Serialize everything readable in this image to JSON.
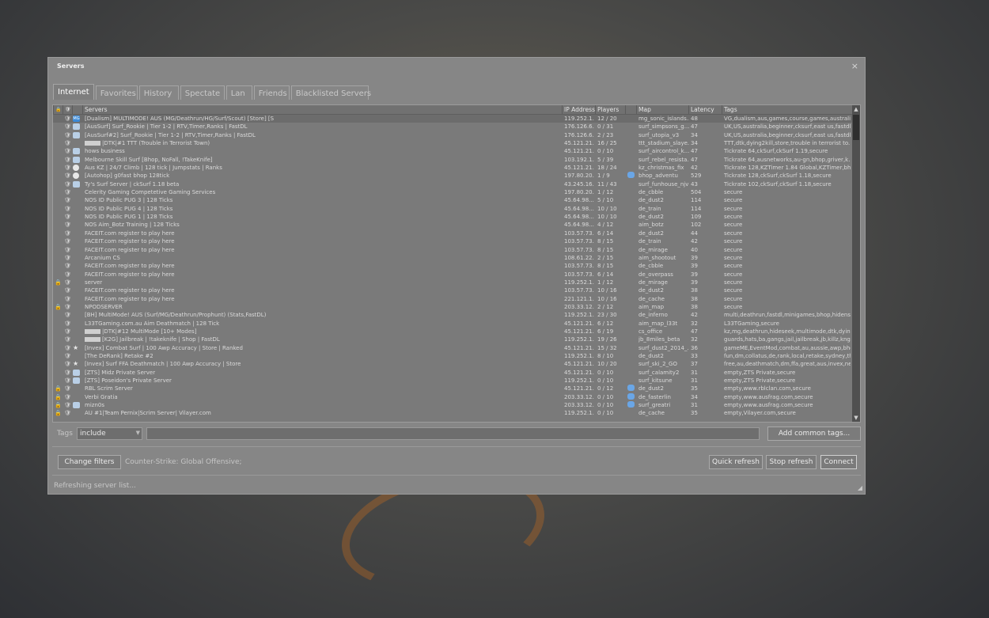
{
  "window": {
    "title": "Servers",
    "close": "×"
  },
  "tabs": [
    "Internet",
    "Favorites",
    "History",
    "Spectate",
    "Lan",
    "Friends",
    "Blacklisted Servers"
  ],
  "columns": {
    "lock": "🔒",
    "secure": "🛡",
    "bots": "",
    "servers": "Servers",
    "ip": "IP Address",
    "players": "Players",
    "fav": "",
    "map": "Map",
    "latency": "Latency",
    "tags": "Tags"
  },
  "rows": [
    {
      "lock": "",
      "icon": "mg",
      "icon_text": "MG",
      "name": "[Dualism] MULTIMODE! AUS (MG/Deathrun/HG/Surf/Scout) [Store] [S",
      "ip": "119.252.1...",
      "players": "12 / 20",
      "fav": "",
      "map": "mg_sonic_islands...",
      "lat": "48",
      "tags": "VG,dualism,aus,games,course,games,australia,..."
    },
    {
      "lock": "",
      "icon": "user",
      "name": "[AusSurf] Surf_Rookie | Tier 1-2 | RTV,Timer,Ranks | FastDL",
      "ip": "176.126.6...",
      "players": "0 / 31",
      "fav": "",
      "map": "surf_simpsons_g...",
      "lat": "47",
      "tags": "UK,US,australia,beginner,cksurf,east us,fastdl..."
    },
    {
      "lock": "",
      "icon": "user",
      "name": "[AusSurf#2] Surf_Rookie | Tier 1-2 | RTV,Timer,Ranks | FastDL",
      "ip": "176.126.6...",
      "players": "2 / 23",
      "fav": "",
      "map": "surf_utopia_v3",
      "lat": "34",
      "tags": "UK,US,australia,beginner,cksurf,east us,fastdl..."
    },
    {
      "lock": "",
      "icon": "blank",
      "name": "|DTK|#1 TTT (Trouble in Terrorist Town)",
      "ip": "45.121.21...",
      "players": "16 / 25",
      "fav": "",
      "map": "ttt_stadium_slaye...",
      "lat": "34",
      "tags": "TTT,dtk,dying2kill,store,trouble in terrorist to..."
    },
    {
      "lock": "",
      "icon": "user",
      "name": "hows business",
      "ip": "45.121.21...",
      "players": "0 / 10",
      "fav": "",
      "map": "surf_aircontrol_k...",
      "lat": "47",
      "tags": "Tickrate 64,ckSurf,ckSurf 1.19,secure"
    },
    {
      "lock": "",
      "icon": "user",
      "name": "Melbourne Skill Surf [Bhop, NoFall, !TakeKnife]",
      "ip": "103.192.1...",
      "players": "5 / 39",
      "fav": "",
      "map": "surf_rebel_resista...",
      "lat": "47",
      "tags": "Tickrate 64,ausnetworks,au-gn,bhop,griver,k..."
    },
    {
      "lock": "",
      "icon": "circle",
      "name": "Aus KZ | 24/7 Climb | 128 tick | Jumpstats | Ranks",
      "ip": "45.121.21...",
      "players": "18 / 24",
      "fav": "",
      "map": "kz_christmas_fix",
      "lat": "42",
      "tags": "Tickrate 128,KZTimer 1.84 Global,KZTimer,bho..."
    },
    {
      "lock": "",
      "icon": "circle",
      "name": "[Autohop] g0fast bhop 128tick",
      "ip": "197.80.20...",
      "players": "1 / 9",
      "fav": "y",
      "map": "bhop_adventu",
      "lat": "529",
      "tags": "Tickrate 128,ckSurf,ckSurf 1.18,secure"
    },
    {
      "lock": "",
      "icon": "user",
      "name": "Ty's Surf Server | ckSurf 1.18 beta",
      "ip": "43.245.16...",
      "players": "11 / 43",
      "fav": "",
      "map": "surf_funhouse_njv",
      "lat": "43",
      "tags": "Tickrate 102,ckSurf,ckSurf 1.18,secure"
    },
    {
      "lock": "",
      "icon": "",
      "name": "Celerity Gaming Competetive Gaming Services",
      "ip": "197.80.20...",
      "players": "1 / 12",
      "fav": "",
      "map": "de_cbble",
      "lat": "504",
      "tags": "secure"
    },
    {
      "lock": "",
      "icon": "",
      "name": "NOS ID Public PUG 3 | 128 Ticks",
      "ip": "45.64.98....",
      "players": "5 / 10",
      "fav": "",
      "map": "de_dust2",
      "lat": "114",
      "tags": "secure"
    },
    {
      "lock": "",
      "icon": "",
      "name": "NOS ID Public PUG 4 | 128 Ticks",
      "ip": "45.64.98....",
      "players": "10 / 10",
      "fav": "",
      "map": "de_train",
      "lat": "114",
      "tags": "secure"
    },
    {
      "lock": "",
      "icon": "",
      "name": "NOS ID Public PUG 1 | 128 Ticks",
      "ip": "45.64.98....",
      "players": "10 / 10",
      "fav": "",
      "map": "de_dust2",
      "lat": "109",
      "tags": "secure"
    },
    {
      "lock": "",
      "icon": "",
      "name": "NOS Aim_Botz Training | 128 Ticks",
      "ip": "45.64.98....",
      "players": "4 / 12",
      "fav": "",
      "map": "aim_botz",
      "lat": "102",
      "tags": "secure"
    },
    {
      "lock": "",
      "icon": "",
      "name": "FACEIT.com register to play here",
      "ip": "103.57.73...",
      "players": "6 / 14",
      "fav": "",
      "map": "de_dust2",
      "lat": "44",
      "tags": "secure"
    },
    {
      "lock": "",
      "icon": "",
      "name": "FACEIT.com register to play here",
      "ip": "103.57.73...",
      "players": "8 / 15",
      "fav": "",
      "map": "de_train",
      "lat": "42",
      "tags": "secure"
    },
    {
      "lock": "",
      "icon": "",
      "name": "FACEIT.com register to play here",
      "ip": "103.57.73...",
      "players": "8 / 15",
      "fav": "",
      "map": "de_mirage",
      "lat": "40",
      "tags": "secure"
    },
    {
      "lock": "",
      "icon": "",
      "name": "Arcanium CS",
      "ip": "108.61.22...",
      "players": "2 / 15",
      "fav": "",
      "map": "aim_shootout",
      "lat": "39",
      "tags": "secure"
    },
    {
      "lock": "",
      "icon": "",
      "name": "FACEIT.com register to play here",
      "ip": "103.57.73...",
      "players": "8 / 15",
      "fav": "",
      "map": "de_cbble",
      "lat": "39",
      "tags": "secure"
    },
    {
      "lock": "",
      "icon": "",
      "name": "FACEIT.com register to play here",
      "ip": "103.57.73...",
      "players": "6 / 14",
      "fav": "",
      "map": "de_overpass",
      "lat": "39",
      "tags": "secure"
    },
    {
      "lock": "🔒",
      "icon": "",
      "name": "server",
      "ip": "119.252.1...",
      "players": "1 / 12",
      "fav": "",
      "map": "de_mirage",
      "lat": "39",
      "tags": "secure"
    },
    {
      "lock": "",
      "icon": "",
      "name": "FACEIT.com register to play here",
      "ip": "103.57.73...",
      "players": "10 / 16",
      "fav": "",
      "map": "de_dust2",
      "lat": "38",
      "tags": "secure"
    },
    {
      "lock": "",
      "icon": "",
      "name": "FACEIT.com register to play here",
      "ip": "221.121.1...",
      "players": "10 / 16",
      "fav": "",
      "map": "de_cache",
      "lat": "38",
      "tags": "secure"
    },
    {
      "lock": "🔒",
      "icon": "",
      "name": "NPODSERVER",
      "ip": "203.33.12...",
      "players": "2 / 12",
      "fav": "",
      "map": "aim_map",
      "lat": "38",
      "tags": "secure"
    },
    {
      "lock": "",
      "icon": "",
      "name": "[BH] MultiMode! AUS (Surf/MG/Deathrun/Prophunt) (Stats,FastDL)",
      "ip": "119.252.1...",
      "players": "23 / 30",
      "fav": "",
      "map": "de_inferno",
      "lat": "42",
      "tags": "multi,deathrun,fastdl,minigames,bhop,hidense..."
    },
    {
      "lock": "",
      "icon": "",
      "name": "L33TGaming.com.au Aim Deathmatch | 128 Tick",
      "ip": "45.121.21...",
      "players": "6 / 12",
      "fav": "",
      "map": "aim_map_l33t",
      "lat": "32",
      "tags": "L33TGaming,secure"
    },
    {
      "lock": "",
      "icon": "blank",
      "name": "|DTK|#12 MultiMode [10+ Modes]",
      "ip": "45.121.21...",
      "players": "6 / 19",
      "fav": "",
      "map": "cs_office",
      "lat": "47",
      "tags": "kz,mg,deathrun,hideseek,multimode,dtk,dying..."
    },
    {
      "lock": "",
      "icon": "blank2",
      "name": "[K2G] Jailbreak | !takeknife | Shop | FastDL",
      "ip": "119.252.1...",
      "players": "19 / 26",
      "fav": "",
      "map": "jb_8miles_beta",
      "lat": "32",
      "tags": "guards,hats,ba,gangs,jail,jailbreak,jb,killz,kng..."
    },
    {
      "lock": "",
      "icon": "staruser",
      "name": "[Invex] Combat Surf | 100 Awp Accuracy | Store | Ranked",
      "ip": "45.121.21...",
      "players": "15 / 32",
      "fav": "",
      "map": "surf_dust2_2014_...",
      "lat": "36",
      "tags": "gameME,EventMod,combat,au,aussie,awp,bho..."
    },
    {
      "lock": "",
      "icon": "",
      "name": "[The DeRank] Retake #2",
      "ip": "119.252.1...",
      "players": "8 / 10",
      "fav": "",
      "map": "de_dust2",
      "lat": "33",
      "tags": "fun,dm,collatus,de,rank,local,retake,sydney,th..."
    },
    {
      "lock": "",
      "icon": "staruser",
      "name": "[Invex] Surf FFA Deathmatch | 100 Awp Accuracy | Store",
      "ip": "45.121.21...",
      "players": "10 / 20",
      "fav": "",
      "map": "surf_ski_2_GO",
      "lat": "37",
      "tags": "free,au,deathmatch,dm,ffa,great,aus,invex,ne..."
    },
    {
      "lock": "",
      "icon": "user",
      "name": "[ZTS] Midz Private Server",
      "ip": "45.121.21...",
      "players": "0 / 10",
      "fav": "",
      "map": "surf_calamity2",
      "lat": "31",
      "tags": "empty,ZTS Private,secure"
    },
    {
      "lock": "",
      "icon": "user",
      "name": "[ZTS] Poseidon's Private Server",
      "ip": "119.252.1...",
      "players": "0 / 10",
      "fav": "",
      "map": "surf_kitsune",
      "lat": "31",
      "tags": "empty,ZTS Private,secure"
    },
    {
      "lock": "🔒",
      "icon": "",
      "name": "RBL Scrim Server",
      "ip": "45.121.21...",
      "players": "0 / 12",
      "fav": "y",
      "map": "de_dust2",
      "lat": "35",
      "tags": "empty,www.rblclan.com,secure"
    },
    {
      "lock": "🔒",
      "icon": "",
      "name": "Verbi Gratia",
      "ip": "203.33.12...",
      "players": "0 / 10",
      "fav": "y",
      "map": "de_fasterlin",
      "lat": "34",
      "tags": "empty,www.ausfrag.com,secure"
    },
    {
      "lock": "🔒",
      "icon": "user",
      "name": "mizn0s",
      "ip": "203.33.12...",
      "players": "0 / 10",
      "fav": "y",
      "map": "surf_greatri",
      "lat": "31",
      "tags": "empty,www.ausfrag.com,secure"
    },
    {
      "lock": "🔒",
      "icon": "",
      "name": "AU #1|Team Pernix|Scrim Server| Vilayer.com",
      "ip": "119.252.1...",
      "players": "0 / 10",
      "fav": "",
      "map": "de_cache",
      "lat": "35",
      "tags": "empty,Vilayer.com,secure"
    }
  ],
  "filters": {
    "tags_label": "Tags",
    "tags_mode": "include",
    "tags_value": "",
    "add_common_tags": "Add common tags...",
    "change_filters": "Change filters",
    "game_label": "Counter-Strike: Global Offensive;"
  },
  "actions": {
    "quick_refresh": "Quick refresh",
    "stop_refresh": "Stop refresh",
    "connect": "Connect"
  },
  "status": "Refreshing server list..."
}
